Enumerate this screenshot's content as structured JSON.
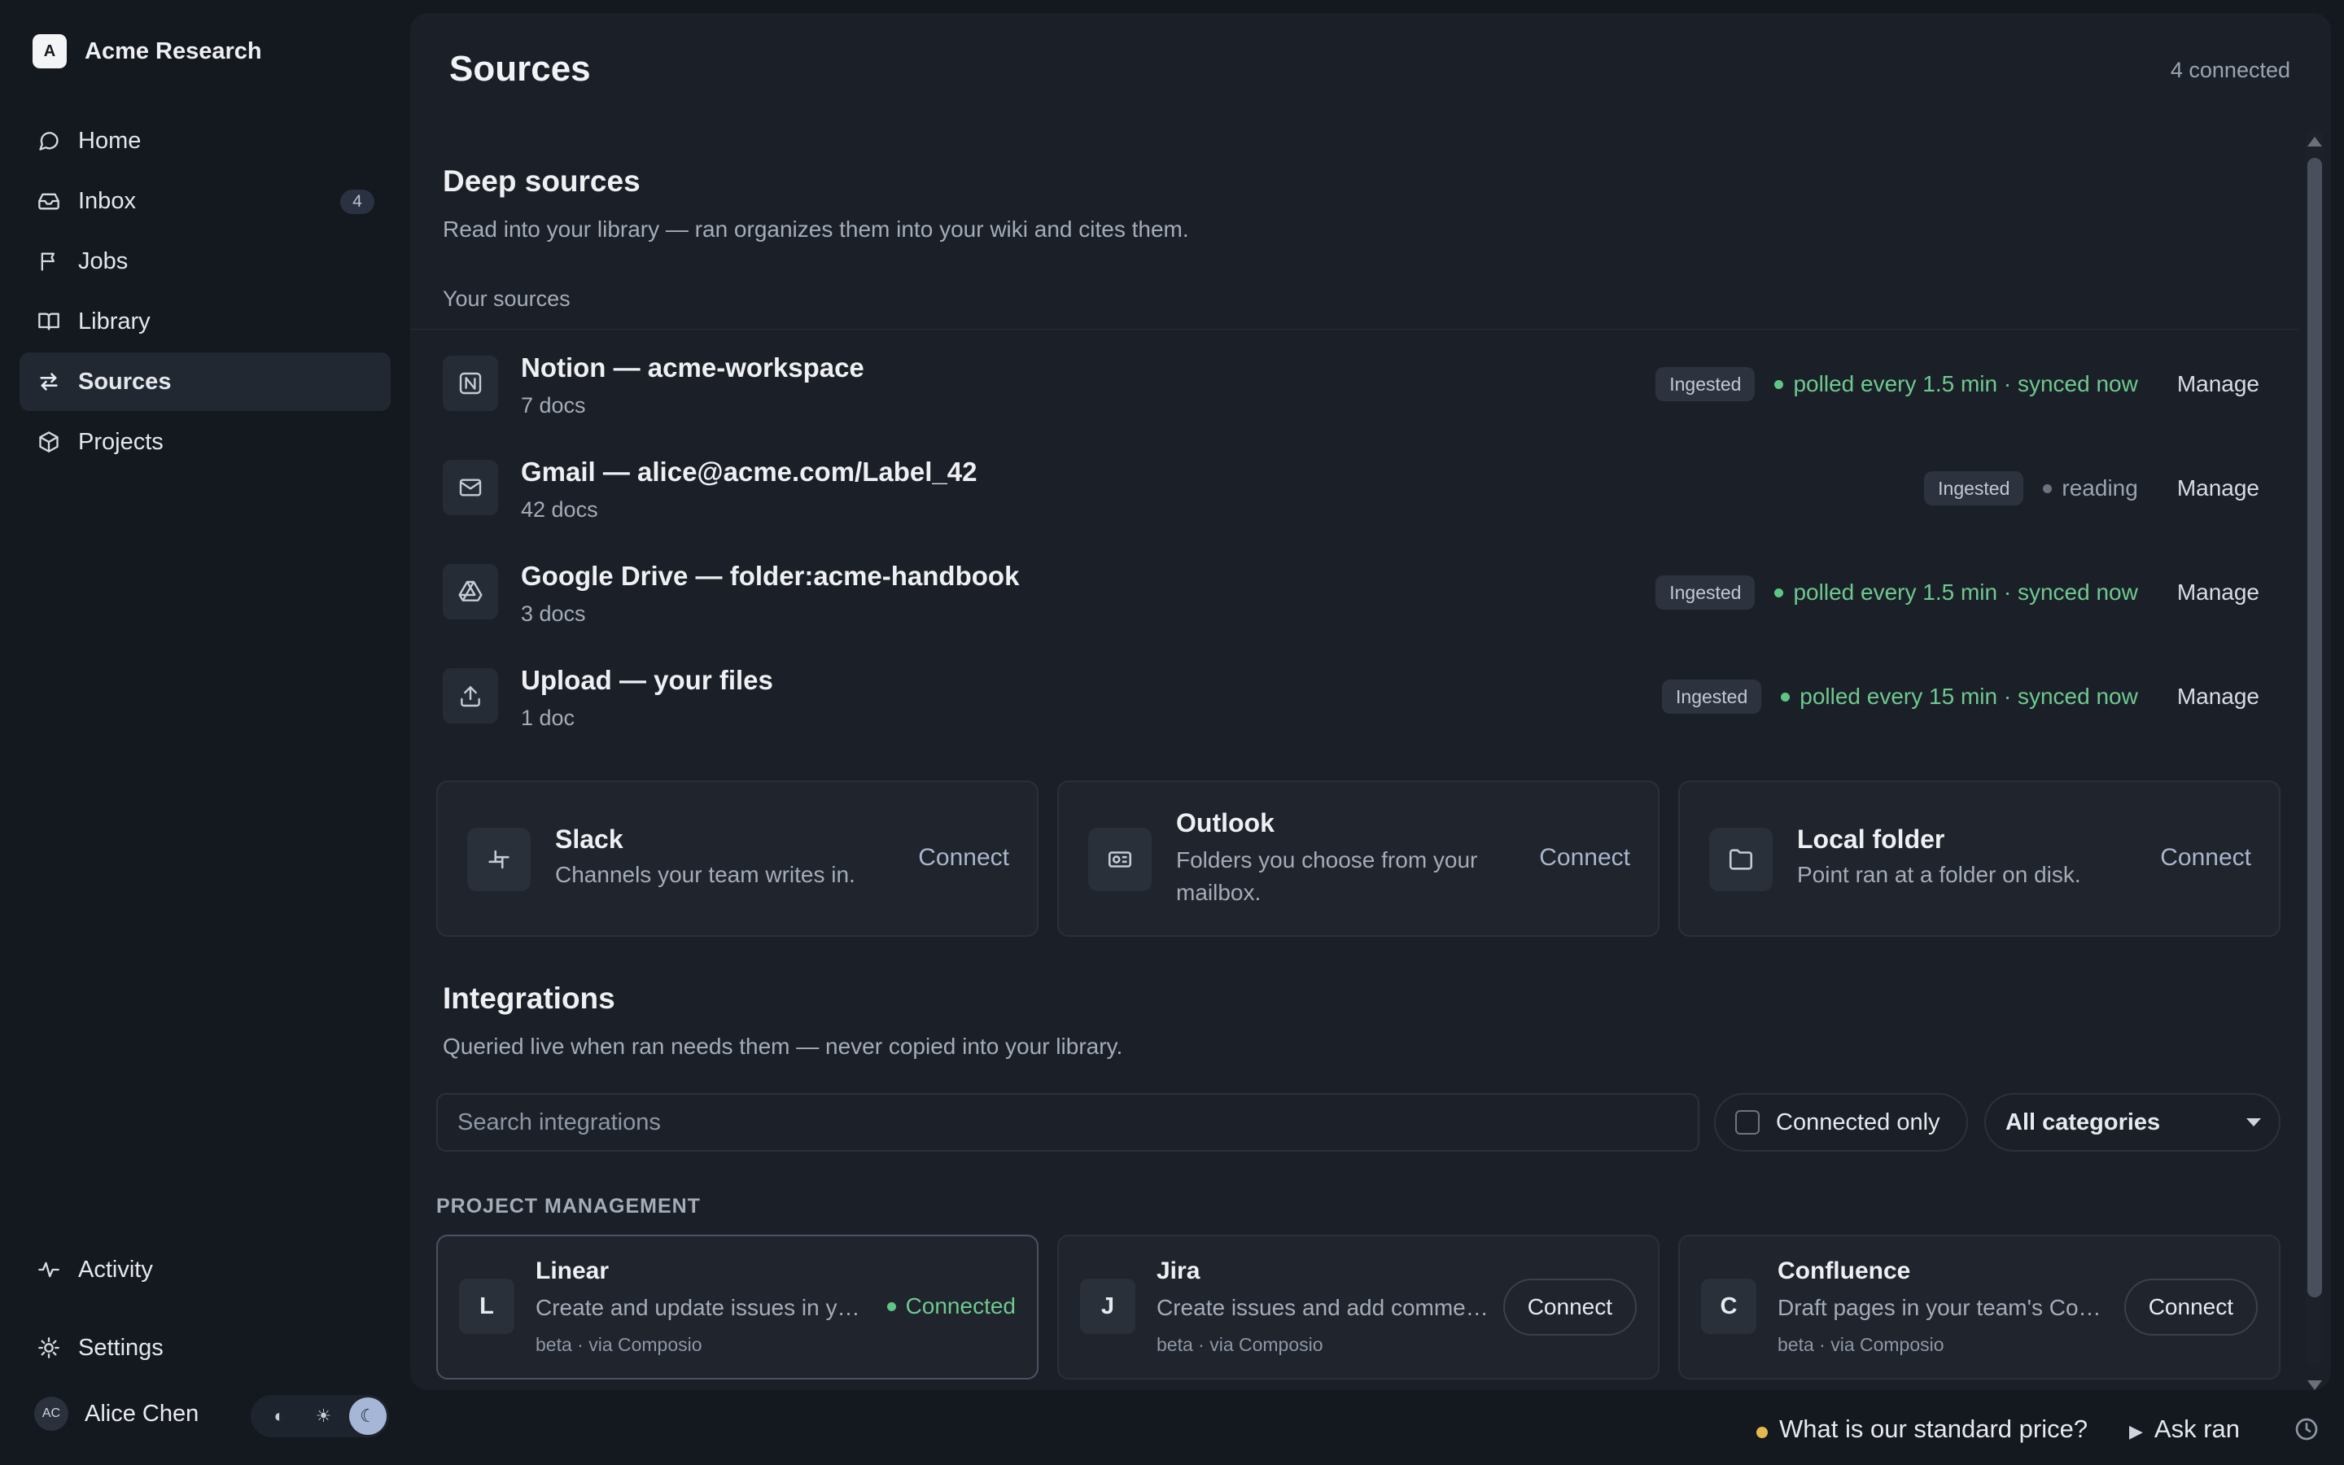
{
  "workspace": {
    "name": "Acme Research",
    "logo_letter": "A"
  },
  "nav": {
    "home": "Home",
    "inbox": "Inbox",
    "inbox_count": "4",
    "jobs": "Jobs",
    "library": "Library",
    "sources": "Sources",
    "projects": "Projects",
    "activity": "Activity",
    "settings": "Settings"
  },
  "user": {
    "initials": "AC",
    "name": "Alice Chen"
  },
  "page": {
    "title": "Sources",
    "connected_count": "4 connected"
  },
  "deep": {
    "title": "Deep sources",
    "description": "Read into your library — ran organizes them into your wiki and cites them.",
    "your_sources_label": "Your sources",
    "sources": [
      {
        "name": "Notion — acme-workspace",
        "docs": "7 docs",
        "badge": "Ingested",
        "status": "polled every 1.5 min · synced now",
        "status_color": "#6ec98f",
        "manage": "Manage",
        "icon": "notion-icon"
      },
      {
        "name": "Gmail — alice@acme.com/Label_42",
        "docs": "42 docs",
        "badge": "Ingested",
        "status": "reading",
        "status_color": "#9aa3b1",
        "manage": "Manage",
        "icon": "mail-icon"
      },
      {
        "name": "Google Drive — folder:acme-handbook",
        "docs": "3 docs",
        "badge": "Ingested",
        "status": "polled every 1.5 min · synced now",
        "status_color": "#6ec98f",
        "manage": "Manage",
        "icon": "drive-icon"
      },
      {
        "name": "Upload — your files",
        "docs": "1 doc",
        "badge": "Ingested",
        "status": "polled every 15 min · synced now",
        "status_color": "#6ec98f",
        "manage": "Manage",
        "icon": "upload-icon"
      }
    ],
    "available": [
      {
        "name": "Slack",
        "description": "Channels your team writes in.",
        "action": "Connect",
        "icon": "slack-icon"
      },
      {
        "name": "Outlook",
        "description": "Folders you choose from your mailbox.",
        "action": "Connect",
        "icon": "outlook-icon"
      },
      {
        "name": "Local folder",
        "description": "Point ran at a folder on disk.",
        "action": "Connect",
        "icon": "folder-icon"
      }
    ]
  },
  "integrations": {
    "title": "Integrations",
    "description": "Queried live when ran needs them — never copied into your library.",
    "search_placeholder": "Search integrations",
    "connected_only_label": "Connected only",
    "category_select": "All categories",
    "category_heading": "PROJECT MANAGEMENT",
    "items": [
      {
        "letter": "L",
        "name": "Linear",
        "description": "Create and update issues in your team's workspace.",
        "meta": "beta · via Composio",
        "action": "Connected",
        "connected": true
      },
      {
        "letter": "J",
        "name": "Jira",
        "description": "Create issues and add comments in Jira projects.",
        "meta": "beta · via Composio",
        "action": "Connect",
        "connected": false
      },
      {
        "letter": "C",
        "name": "Confluence",
        "description": "Draft pages in your team's Confluence space.",
        "meta": "beta · via Composio",
        "action": "Connect",
        "connected": false
      }
    ]
  },
  "bottom": {
    "question": "What is our standard price?",
    "ask_label": "Ask ran"
  },
  "colors": {
    "background": "#14181f",
    "panel": "#1b2028",
    "accent_green": "#6ec98f",
    "question_dot": "#e5b84f"
  }
}
